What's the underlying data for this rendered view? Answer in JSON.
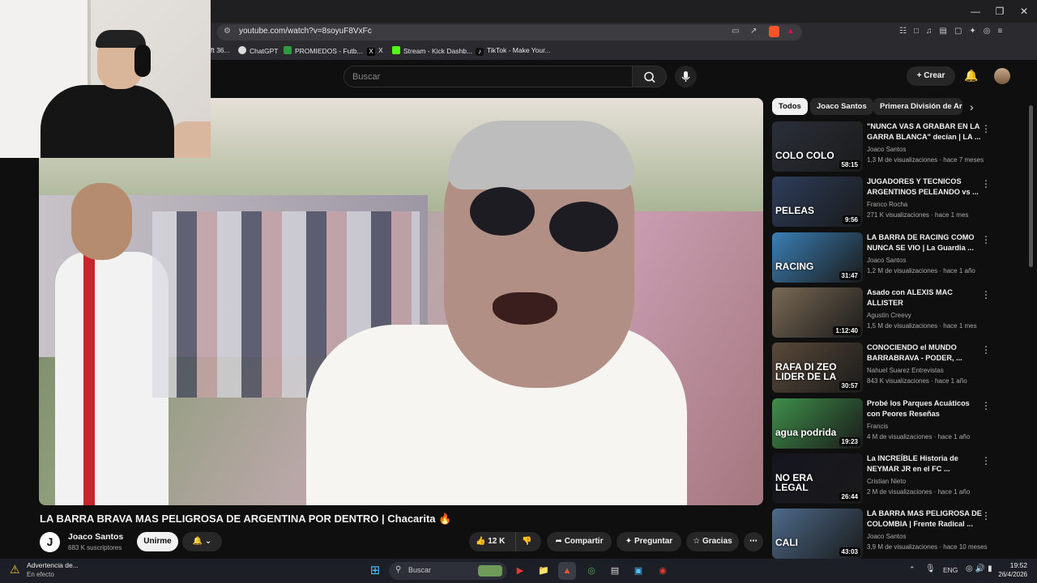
{
  "browser": {
    "url": "youtube.com/watch?v=8soyuF8VxFc",
    "bookmarks": [
      "ft 36...",
      "ChatGPT",
      "PROMIEDOS - Futb...",
      "X",
      "Stream - Kick Dashb...",
      "TikTok - Make Your..."
    ]
  },
  "youtube": {
    "search_placeholder": "Buscar",
    "create_label": "Crear"
  },
  "video": {
    "title": "LA BARRA BRAVA MAS PELIGROSA DE ARGENTINA POR DENTRO | Chacarita 🔥",
    "channel": "Joaco Santos",
    "channel_initial": "J",
    "subscribers": "683 K suscriptores",
    "join_label": "Unirme",
    "likes": "12 K",
    "share_label": "Compartir",
    "ask_label": "Preguntar",
    "thanks_label": "Gracias"
  },
  "chips": [
    "Todos",
    "Joaco Santos",
    "Primera División de Arg"
  ],
  "related": [
    {
      "title": "\"NUNCA VAS A GRABAR EN LA GARRA BLANCA\" decían | LA ...",
      "channel": "Joaco Santos",
      "views": "1,3 M de visualizaciones",
      "age": "hace 7 meses",
      "duration": "58:15",
      "thumb_text": "COLO COLO",
      "color": "#2a2f38"
    },
    {
      "title": "JUGADORES Y TECNICOS ARGENTINOS PELEANDO vs ...",
      "channel": "Franco Rocha",
      "views": "271 K visualizaciones",
      "age": "hace 1 mes",
      "duration": "9:56",
      "thumb_text": "PELEAS",
      "color": "#2d3d5a"
    },
    {
      "title": "LA BARRA DE RACING COMO NUNCA SE VIO | La Guardia ...",
      "channel": "Joaco Santos",
      "views": "1,2 M de visualizaciones",
      "age": "hace 1 año",
      "duration": "31:47",
      "thumb_text": "RACING",
      "color": "#3a7fb5"
    },
    {
      "title": "Asado con ALEXIS MAC ALLISTER",
      "channel": "Agustín Creevy",
      "views": "1,5 M de visualizaciones",
      "age": "hace 1 mes",
      "duration": "1:12:40",
      "thumb_text": "",
      "color": "#7a6a55"
    },
    {
      "title": "CONOCIENDO el MUNDO BARRABRAVA - PODER, ...",
      "channel": "Nahuel Suarez Entrevistas",
      "views": "843 K visualizaciones",
      "age": "hace 1 año",
      "duration": "30:57",
      "thumb_text": "RAFA DI ZEO LIDER DE LA",
      "color": "#5a4a3a"
    },
    {
      "title": "Probé los Parques Acuáticos con Peores Reseñas",
      "channel": "Francis",
      "views": "4 M de visualizaciones",
      "age": "hace 1 año",
      "duration": "19:23",
      "thumb_text": "agua podrida",
      "color": "#3f8f4a"
    },
    {
      "title": "La INCREÍBLE Historia de NEYMAR JR en el FC ...",
      "channel": "Cristian Nieto",
      "views": "2 M de visualizaciones",
      "age": "hace 1 año",
      "duration": "26:44",
      "thumb_text": "NO ERA LEGAL",
      "color": "#151520"
    },
    {
      "title": "LA BARRA MAS PELIGROSA DE COLOMBIA | Frente Radical ...",
      "channel": "Joaco Santos",
      "views": "3,9 M de visualizaciones",
      "age": "hace 10 meses",
      "duration": "43:03",
      "thumb_text": "CALI",
      "color": "#4d6a8a"
    }
  ],
  "taskbar": {
    "notification_title": "Advertencia de...",
    "notification_sub": "En efecto",
    "search_label": "Buscar",
    "language": "ENG",
    "time": "19:52",
    "date": "26/4/2026"
  }
}
